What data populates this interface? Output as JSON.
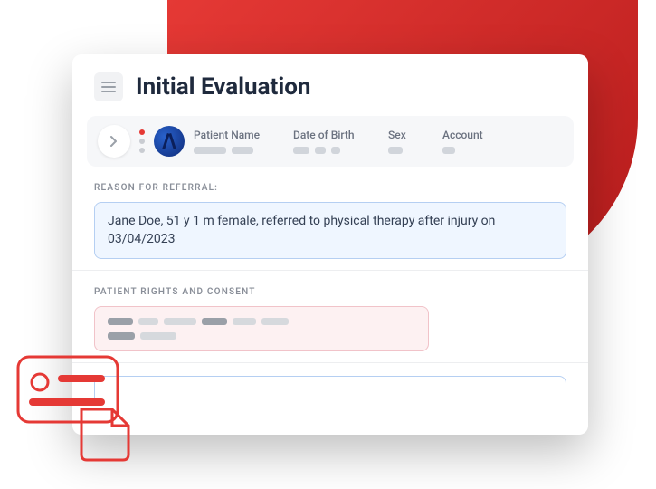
{
  "header": {
    "title": "Initial Evaluation"
  },
  "patient_bar": {
    "fields": [
      {
        "label": "Patient Name"
      },
      {
        "label": "Date of Birth"
      },
      {
        "label": "Sex"
      },
      {
        "label": "Account"
      }
    ]
  },
  "sections": {
    "referral": {
      "label": "REASON FOR REFERRAL:",
      "text": "Jane Doe, 51 y 1 m female, referred to physical therapy after injury on 03/04/2023"
    },
    "consent": {
      "label": "PATIENT RIGHTS AND CONSENT"
    }
  },
  "colors": {
    "accent_red": "#e53935",
    "accent_red_dark": "#b71c1c",
    "highlight_blue_border": "#b5cff2",
    "highlight_blue_bg": "#eff6ff",
    "highlight_pink_border": "#f1c3c9",
    "highlight_pink_bg": "#fdf1f2"
  }
}
